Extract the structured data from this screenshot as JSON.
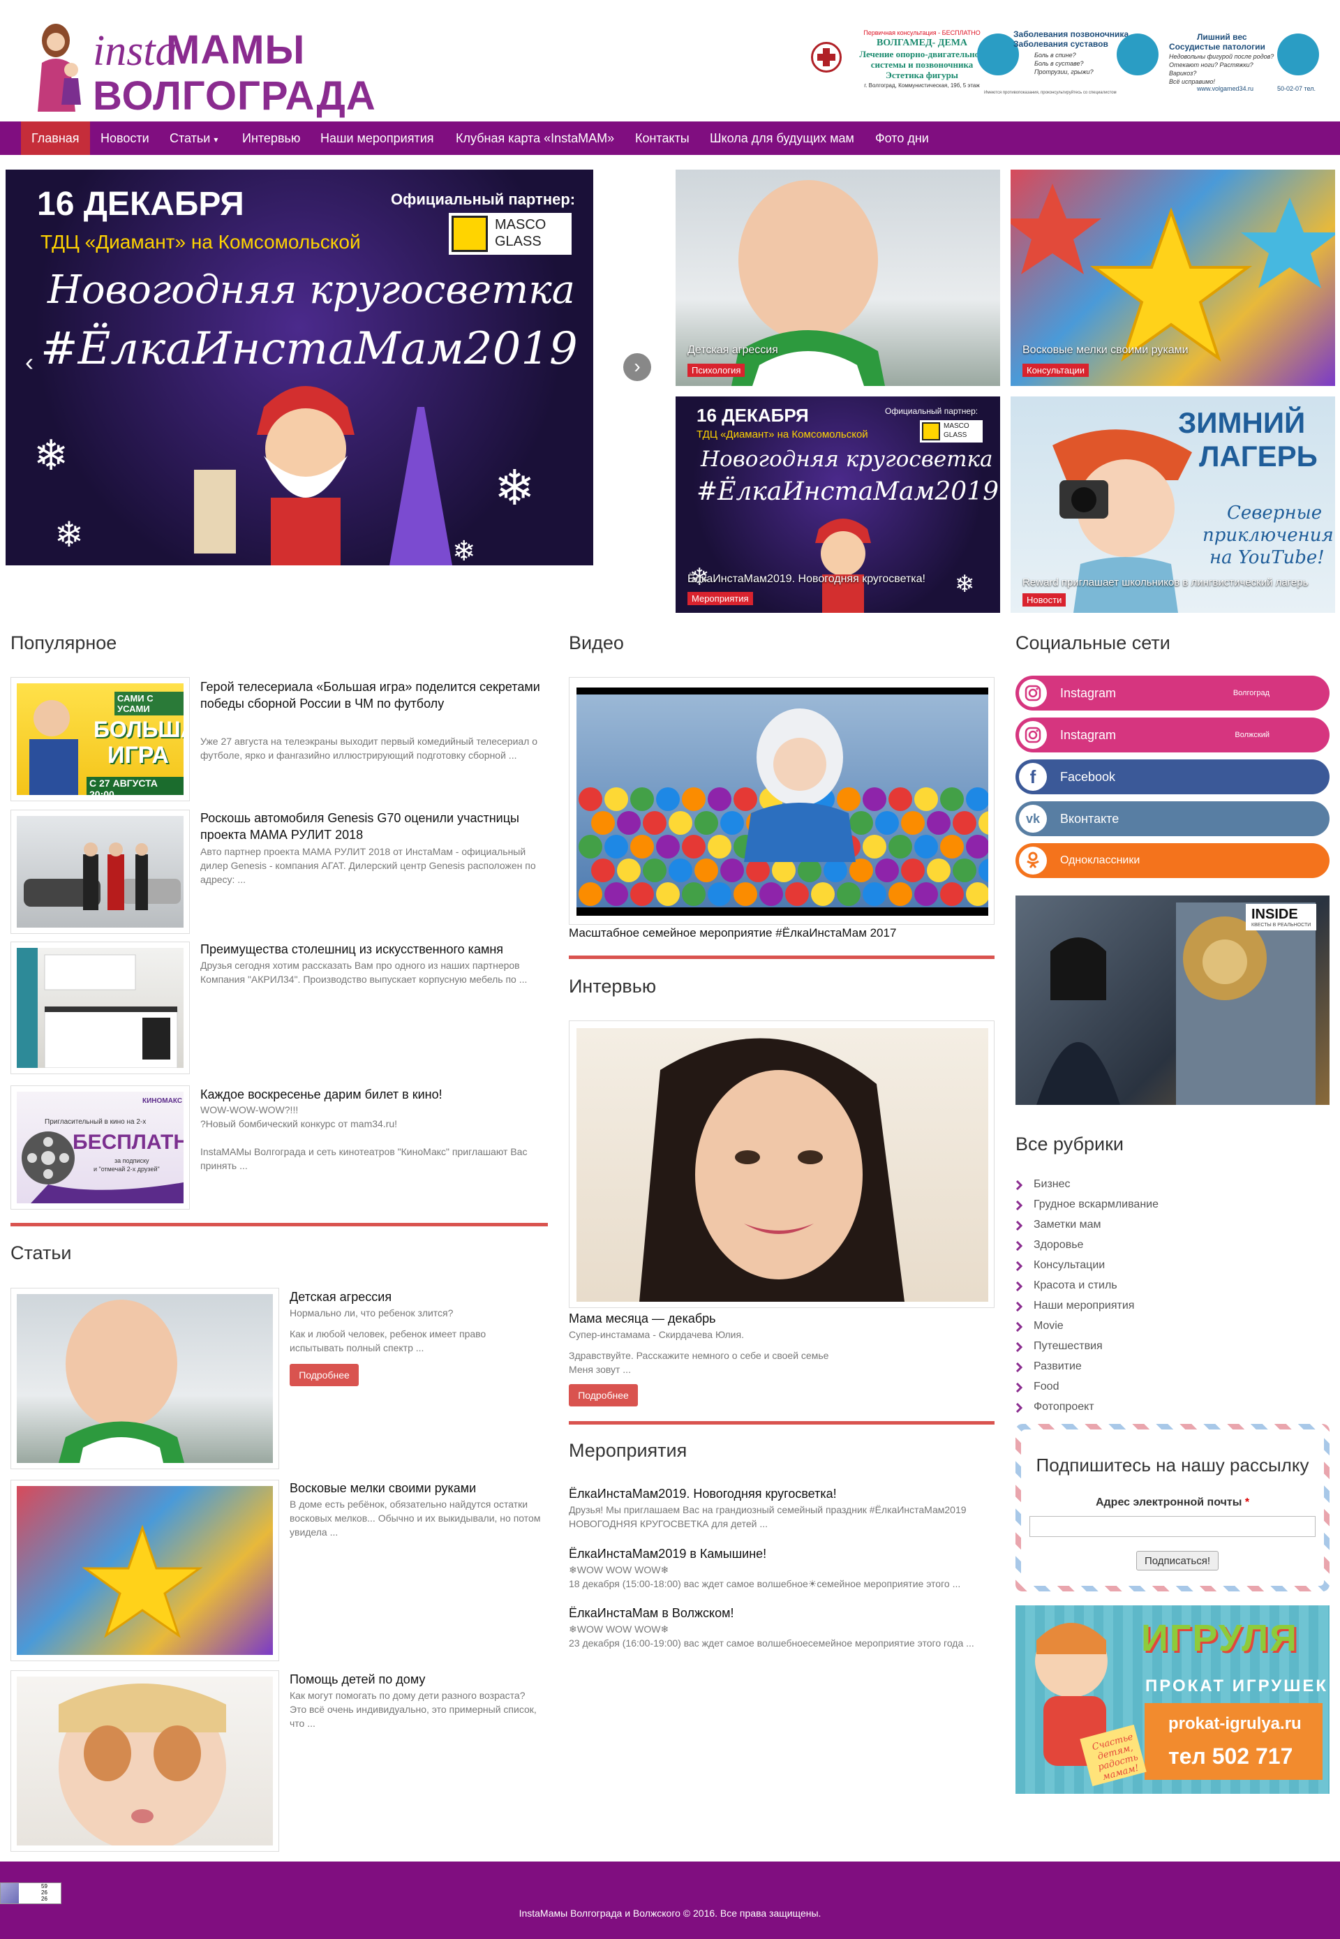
{
  "header": {
    "logo_insta": "insta",
    "logo_line1": "МАМЫ",
    "logo_line2": "ВОЛГОГРАДА",
    "ad": {
      "free": "Первичная консультация - БЕСПЛАТНО",
      "brand": "ВОЛГАМЕД- ДЕМА",
      "line1": "Лечение опорно-двигательной",
      "line2": "системы и позвоночника",
      "line3": "Эстетика фигуры",
      "addr": "г. Волгоград, Коммунистическая, 19б, 5 этаж",
      "col2_title1": "Заболевания позвоночника",
      "col2_title2": "Заболевания суставов",
      "col2_q1": "Боль в спине?",
      "col2_q2": "Боль в суставе?",
      "col2_q3": "Протрузии, грыжи?",
      "col3_title1": "Лишний вес",
      "col3_title2": "Сосудистые патологии",
      "col3_q1": "Недовольны фигурой после родов?",
      "col3_q2": "Отекают ноги? Растяжки?",
      "col3_q3": "Варикоз?",
      "col3_q4": "Всё исправимо!",
      "site": "www.volgamed34.ru",
      "phone": "50-02-07 тел.",
      "disclaimer": "Имеются противопоказания, проконсультируйтесь со специалистом"
    }
  },
  "nav": {
    "items": [
      "Главная",
      "Новости",
      "Статьи",
      "Интервью",
      "Наши мероприятия",
      "Клубная карта «InstaМАМ»",
      "Контакты",
      "Школа для будущих мам",
      "Фото дни"
    ],
    "caret": "▾"
  },
  "slider": {
    "date": "16 ДЕКАБРЯ",
    "place": "ТДЦ «Диамант» на Комсомольской",
    "partner": "Официальный партнер:",
    "partner_brand1": "MASCO",
    "partner_brand2": "GLASS",
    "script1": "Новогодняя кругосветка",
    "script2": "#ЁлкаИнстаМам2019",
    "prev": "‹",
    "next": "›"
  },
  "tiles": [
    {
      "caption": "Детская агрессия",
      "tag": "Психология"
    },
    {
      "caption": "Восковые мелки своими руками",
      "tag": "Консультации"
    },
    {
      "caption": "ЁлкаИнстаМам2019. Новогодняя кругосветка!",
      "tag": "Мероприятия",
      "date": "16 ДЕКАБРЯ",
      "place": "ТДЦ «Диамант» на Комсомольской",
      "partner": "Официальный партнер:",
      "brand1": "MASCO",
      "brand2": "GLASS",
      "script1": "Новогодняя кругосветка",
      "script2": "#ЁлкаИнстаМам2019"
    },
    {
      "caption": "Reward приглашает школьников в лингвистический лагерь",
      "tag": "Новости",
      "img_l1": "ЗИМНИЙ",
      "img_l2": "ЛАГЕРЬ",
      "img_s1": "Северные",
      "img_s2": "приключения",
      "img_s3": "на YouTube!"
    }
  ],
  "popular": {
    "title": "Популярное",
    "items": [
      {
        "title": "Герой телесериала «Большая игра» поделится секретами победы сборной России в ЧМ по футболу",
        "excerpt": "Уже 27 августа на телеэкраны выходит первый комедийный телесериал о футболе, ярко и фангазийно иллюстрирующий подготовку сборной ...",
        "img_top": "САМИ С УСАМИ",
        "img_big1": "БОЛЬШАЯ",
        "img_big2": "ИГРА",
        "img_date": "С 27 АВГУСТА 20:00"
      },
      {
        "title": "Роскошь автомобиля Genesis G70 оценили участницы проекта МАМА РУЛИТ 2018",
        "excerpt": "Авто партнер проекта МАМА РУЛИТ 2018 от ИнстаМам - официальный дилер Genesis - компания АГАТ. Дилерский центр Genesis расположен по адресу: ..."
      },
      {
        "title": "Преимущества столешниц из искусственного камня",
        "excerpt": "Друзья сегодня хотим рассказать Вам про одного из наших партнеров Компания \"АКРИЛ34\". Производство выпускает корпусную мебель по ..."
      },
      {
        "title": "Каждое воскресенье дарим билет в кино!",
        "excerpt_line1": "WOW-WOW-WOW?!!!",
        "excerpt_line2": "?Новый бомбический конкурс от mam34.ru!",
        "excerpt": "InstaМАМы Волгограда и сеть кинотеатров \"КиноМакс\" приглашают Вас принять ...",
        "img_brand": "КИНОМАКС",
        "img_small": "Пригласительный в кино на 2-х",
        "img_big": "БЕСПЛАТНО",
        "img_sub1": "за подписку",
        "img_sub2": "и \"отмечай 2-х друзей\""
      }
    ]
  },
  "articles": {
    "title": "Статьи",
    "items": [
      {
        "title": "Детская агрессия",
        "line1": "Нормально ли, что ребенок злится?",
        "excerpt": "Как и любой человек, ребенок имеет право испытывать полный спектр ...",
        "button": "Подробнее"
      },
      {
        "title": "Восковые мелки своими руками",
        "excerpt": "В доме есть ребёнок, обязательно найдутся остатки восковых мелков... Обычно и их выкидывали, но потом увидела ..."
      },
      {
        "title": "Помощь детей по дому",
        "excerpt": "Как могут помогать по дому дети разного возраста? Это всё очень индивидуально, это примерный список, что ..."
      }
    ]
  },
  "video": {
    "title": "Видео",
    "caption": "Масштабное семейное мероприятие #ЁлкаИнстаМам 2017"
  },
  "interview": {
    "title": "Интервью",
    "post_title": "Мама месяца — декабрь",
    "subtitle": "Супер-инстамама - Скирдачева Юлия.",
    "excerpt_line1": "Здравствуйте. Расскажите немного о себе и своей семье",
    "excerpt_line2": "Меня зовут ...",
    "button": "Подробнее"
  },
  "events": {
    "title": "Мероприятия",
    "items": [
      {
        "title": "ЁлкаИнстаМам2019. Новогодняя кругосветка!",
        "line1": "Друзья! Мы приглашаем Вас на грандиозный семейный праздник #ЁлкаИнстаМам2019",
        "line2": "НОВОГОДНЯЯ КРУГОСВЕТКА для детей ..."
      },
      {
        "title": "ЁлкаИнстаМам2019 в Камышине!",
        "line1": "❄WOW WOW WOW❄",
        "line2": "18 декабря (15:00-18:00) вас ждет самое волшебное☀семейное мероприятие этого ..."
      },
      {
        "title": "ЁлкаИнстаМам в Волжском!",
        "line1": "❄WOW WOW WOW❄",
        "line2": "23 декабря (16:00-19:00) вас ждет самое волшебноесемейное мероприятие этого года ..."
      }
    ]
  },
  "social": {
    "title": "Социальные сети",
    "items": [
      {
        "label": "Instagram",
        "sub": "Волгоград",
        "color": "#d6357f",
        "icon": "instagram-icon"
      },
      {
        "label": "Instagram",
        "sub": "Волжский",
        "color": "#d6357f",
        "icon": "instagram-icon"
      },
      {
        "label": "Facebook",
        "sub": "",
        "color": "#3b5998",
        "icon": "facebook-icon"
      },
      {
        "label": "Вконтакте",
        "sub": "",
        "color": "#587ea3",
        "icon": "vk-icon"
      },
      {
        "label": "Одноклассники",
        "sub": "",
        "color": "#f4731c",
        "icon": "odnoklassniki-icon"
      }
    ]
  },
  "inside_banner": {
    "brand": "INSIDE",
    "sub": "КВЕСТЫ В РЕАЛЬНОСТИ"
  },
  "rubrics": {
    "title": "Все рубрики",
    "items": [
      "Бизнес",
      "Грудное вскармливание",
      "Заметки мам",
      "Здоровье",
      "Консультации",
      "Красота и стиль",
      "Наши мероприятия",
      "Movie",
      "Путешествия",
      "Развитие",
      "Food",
      "Фотопроект"
    ]
  },
  "newsletter": {
    "title": "Подпишитесь на нашу рассылку",
    "label": "Адрес электронной почты",
    "required": "*",
    "value": "",
    "placeholder": "",
    "button": "Подписаться!"
  },
  "igrulya": {
    "logo": "ИГРУЛЯ",
    "sub": "ПРОКАТ ИГРУШЕК",
    "site": "prokat-igrulya.ru",
    "phone": "тел 502 717",
    "slogan1": "Счастье",
    "slogan2": "детям,",
    "slogan3": "радость",
    "slogan4": "мамам!"
  },
  "footer": {
    "text": "InstaМамы Волгограда и Волжского © 2016. Все права защищены.",
    "counter": [
      "59",
      "26",
      "26"
    ]
  },
  "colors": {
    "brand": "#800e80",
    "accent": "#d9534f",
    "tag": "#d9232e"
  }
}
